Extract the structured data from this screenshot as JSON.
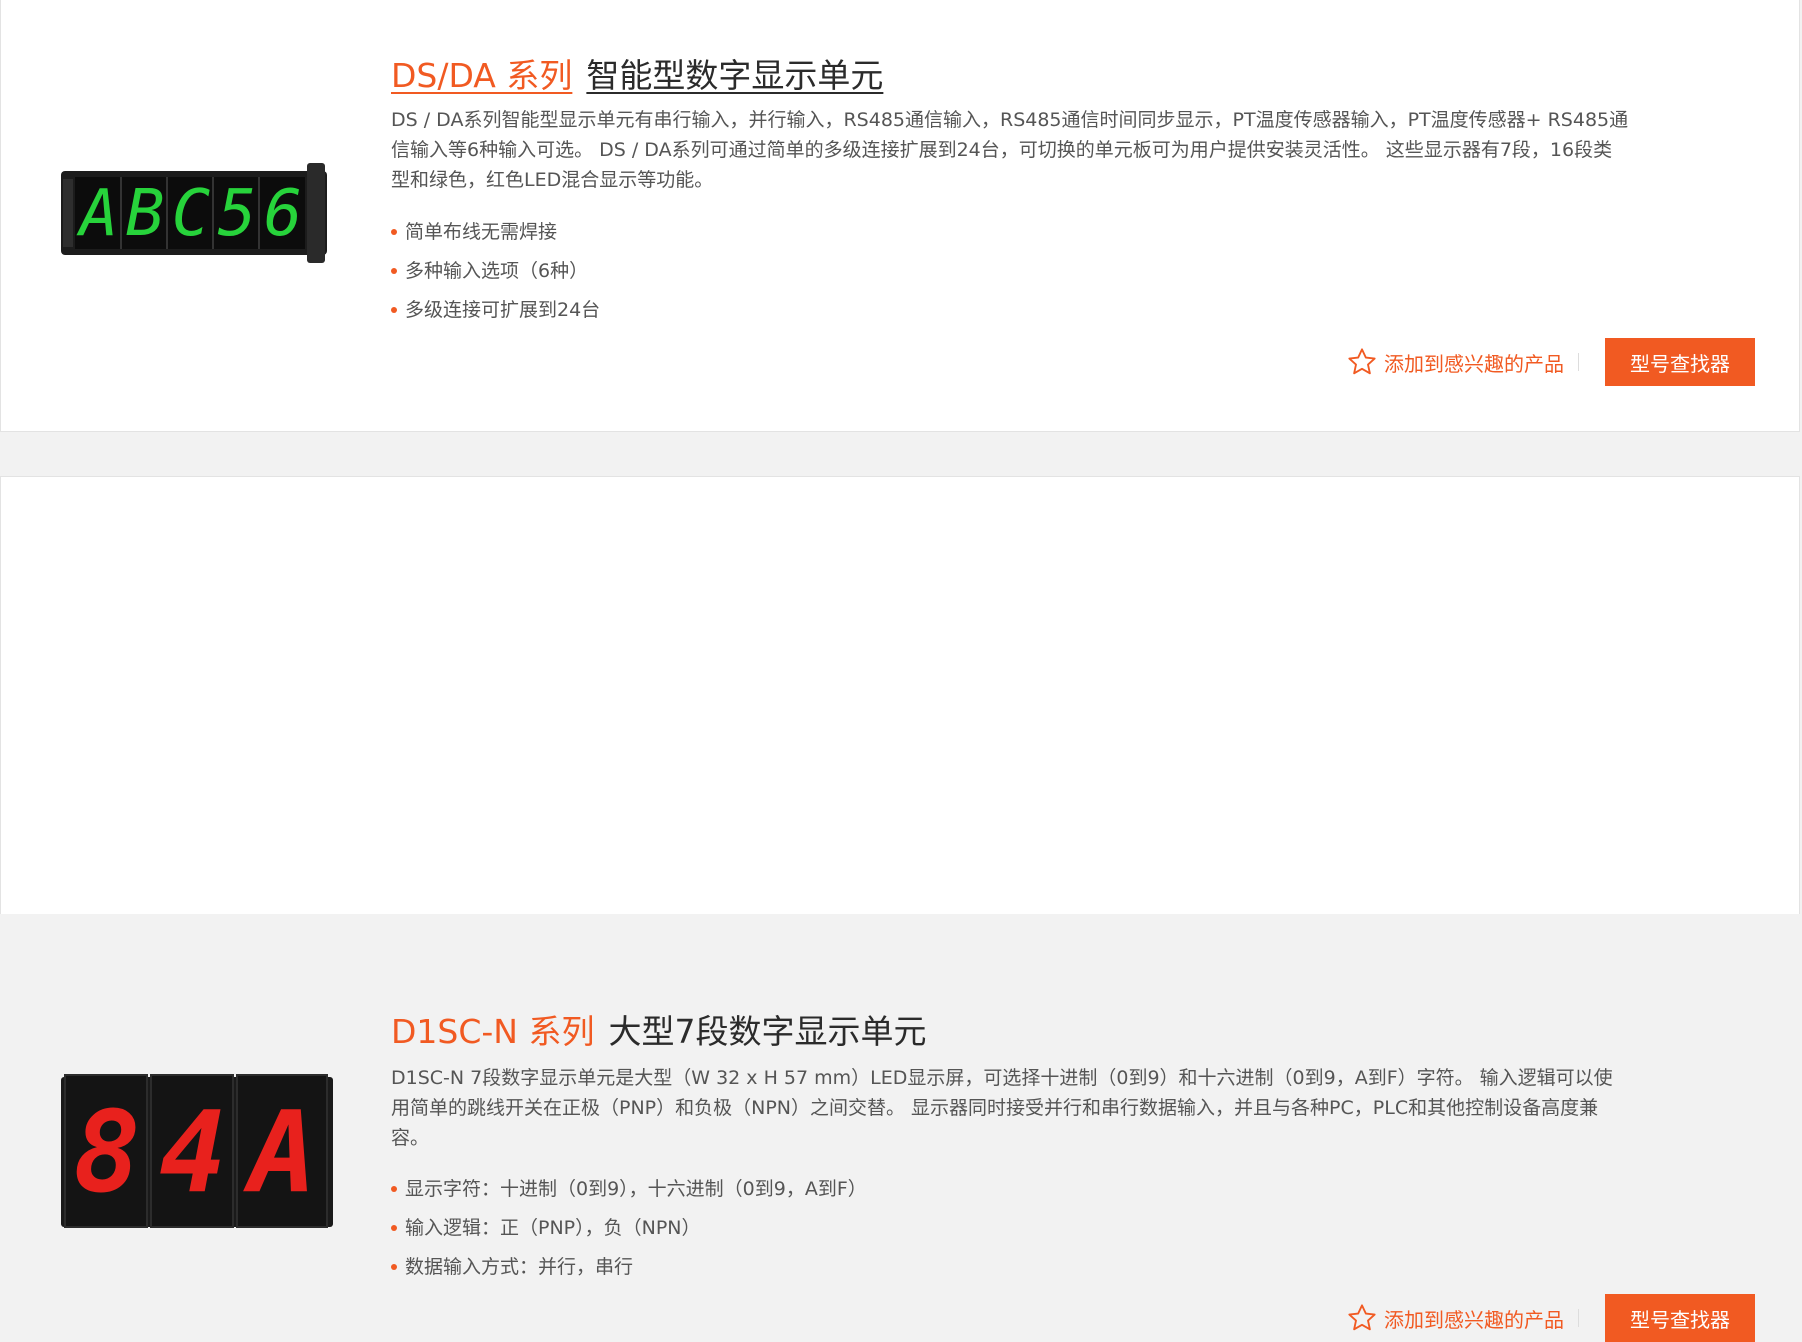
{
  "products": [
    {
      "series": "DS/DA 系列",
      "name": "智能型数字显示单元",
      "description": "DS / DA系列智能型显示单元有串行输入，并行输入，RS485通信输入，RS485通信时间同步显示，PT温度传感器输入，PT温度传感器+ RS485通信输入等6种输入可选。 DS / DA系列可通过简单的多级连接扩展到24台，可切换的单元板可为用户提供安装灵活性。 这些显示器有7段，16段类型和绿色，红色LED混合显示等功能。",
      "features": [
        "简单布线无需焊接",
        "多种输入选项（6种）",
        "多级连接可扩展到24台"
      ],
      "display_text": "ABC56",
      "display_color": "#27d33b",
      "fav_label": "添加到感兴趣的产品",
      "finder_label": "型号查找器"
    },
    {
      "series": "D1SC-N 系列",
      "name": "大型7段数字显示单元",
      "description": "D1SC-N 7段数字显示单元是大型（W 32 x H 57 mm）LED显示屏，可选择十进制（0到9）和十六进制（0到9，A到F）字符。 输入逻辑可以使用简单的跳线开关在正极（PNP）和负极（NPN）之间交替。 显示器同时接受并行和串行数据输入，并且与各种PC，PLC和其他控制设备高度兼容。",
      "features": [
        "显示字符：十进制（0到9），十六进制（0到9，A到F）",
        "输入逻辑：正（PNP），负（NPN）",
        "数据输入方式：并行，串行"
      ],
      "display_text": "84A",
      "display_color": "#e8211d",
      "fav_label": "添加到感兴趣的产品",
      "finder_label": "型号查找器"
    }
  ],
  "colors": {
    "accent": "#f15a22",
    "text": "#333333",
    "muted": "#555555"
  }
}
